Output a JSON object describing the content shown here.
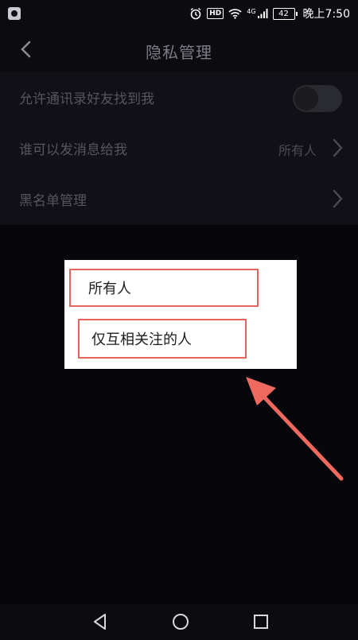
{
  "status_bar": {
    "hd_label": "HD",
    "network_label": "4G",
    "battery_level": "42",
    "time": "晚上7:50"
  },
  "header": {
    "title": "隐私管理"
  },
  "settings": {
    "items": [
      {
        "label": "允许通讯录好友找到我",
        "control": "toggle",
        "enabled": false
      },
      {
        "label": "谁可以发消息给我",
        "value": "所有人",
        "control": "chevron"
      },
      {
        "label": "黑名单管理",
        "control": "chevron"
      }
    ]
  },
  "popup": {
    "options": [
      {
        "label": "所有人"
      },
      {
        "label": "仅互相关注的人"
      }
    ]
  },
  "colors": {
    "background": "#07070b",
    "panel": "#101016",
    "highlight_border": "#e6665f",
    "arrow": "#f0695f"
  }
}
